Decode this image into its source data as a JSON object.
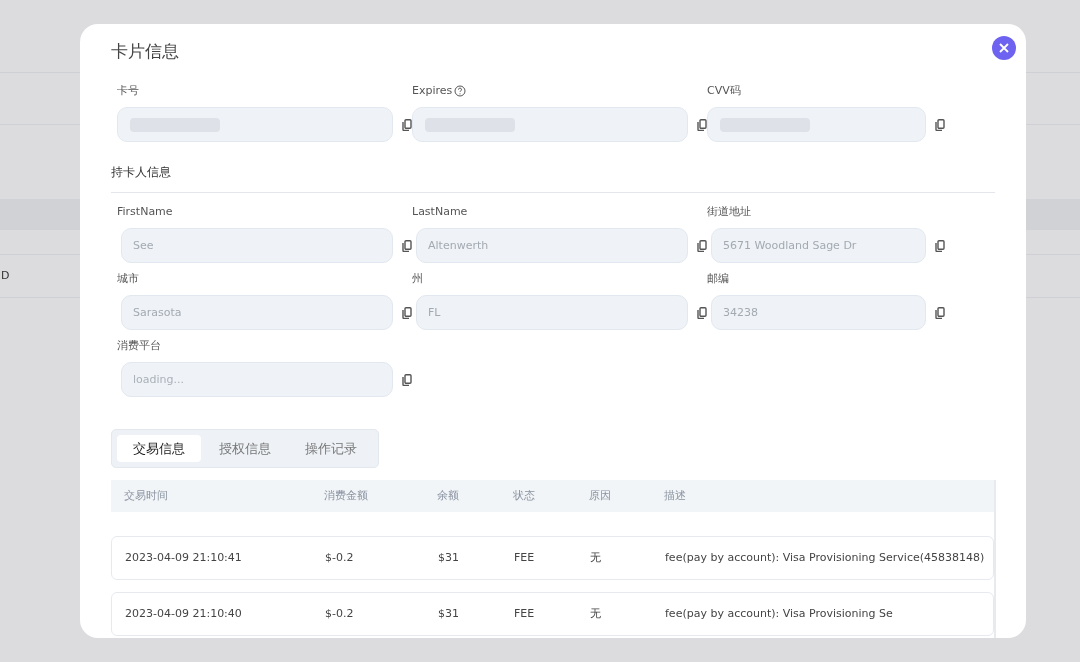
{
  "background": {
    "row_text": "D"
  },
  "dialog": {
    "title": "卡片信息"
  },
  "card_fields": [
    {
      "label": "卡号",
      "help": false,
      "kind": "redacted"
    },
    {
      "label": "Expires",
      "help": true,
      "kind": "redacted"
    },
    {
      "label": "CVV码",
      "help": false,
      "kind": "redacted"
    }
  ],
  "holder_section": {
    "title": "持卡人信息"
  },
  "holder_fields": [
    {
      "label": "FirstName",
      "kind": "text",
      "value": "See"
    },
    {
      "label": "LastName",
      "kind": "text",
      "value": "Altenwerth"
    },
    {
      "label": "街道地址",
      "kind": "text",
      "value": "5671 Woodland Sage Dr"
    },
    {
      "label": "城市",
      "kind": "text",
      "value": "Sarasota"
    },
    {
      "label": "州",
      "kind": "text",
      "value": "FL"
    },
    {
      "label": "邮编",
      "kind": "text",
      "value": "34238"
    },
    {
      "label": "消费平台",
      "kind": "placeholder",
      "placeholder": "loading..."
    }
  ],
  "tabs": [
    {
      "label": "交易信息",
      "selected": true
    },
    {
      "label": "授权信息",
      "selected": false
    },
    {
      "label": "操作记录",
      "selected": false
    }
  ],
  "table": {
    "columns": [
      "交易时间",
      "消费金额",
      "余额",
      "状态",
      "原因",
      "描述"
    ],
    "rows": [
      [
        "2023-04-09 21:10:41",
        "$-0.2",
        "$31",
        "FEE",
        "无",
        "fee(pay by account): Visa Provisioning Service(45838148)"
      ],
      [
        "2023-04-09 21:10:40",
        "$-0.2",
        "$31",
        "FEE",
        "无",
        "fee(pay by account): Visa Provisioning Se"
      ]
    ]
  }
}
